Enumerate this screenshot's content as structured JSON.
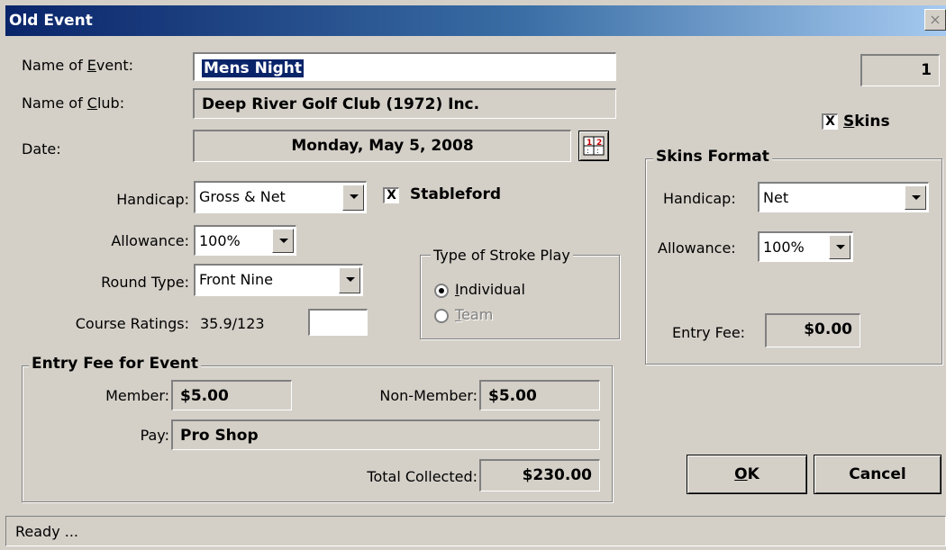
{
  "window": {
    "title": "Old Event",
    "close_label": "×"
  },
  "event": {
    "name_label_prefix": "Name of ",
    "name_label_key": "E",
    "name_label_suffix": "vent:",
    "name_value": "Mens Night",
    "club_label_prefix": "Name of ",
    "club_label_key": "C",
    "club_label_suffix": "lub:",
    "club_value": "Deep River Golf Club (1972) Inc.",
    "date_label": "Date:",
    "date_value": "Monday, May 5, 2008",
    "calendar_icon": "calendar-icon",
    "event_number": "1"
  },
  "settings": {
    "handicap_label": "Handicap:",
    "handicap_value": "Gross & Net",
    "stableford_label": "Stableford",
    "stableford_checked": true,
    "stableford_mark": "X",
    "allowance_label": "Allowance:",
    "allowance_value": "100%",
    "round_type_label": "Round Type:",
    "round_type_value": "Front Nine",
    "course_ratings_label": "Course Ratings:",
    "course_ratings_value": "35.9/123",
    "course_ratings_input": ""
  },
  "stroke_play": {
    "title": "Type of Stroke Play",
    "individual_key": "I",
    "individual_rest": "ndividual",
    "individual_selected": true,
    "team_key": "T",
    "team_rest": "eam",
    "team_selected": false
  },
  "entry_fee": {
    "title": "Entry Fee for Event",
    "member_label": "Member:",
    "member_value": "$5.00",
    "non_member_label": "Non-Member:",
    "non_member_value": "$5.00",
    "pay_label": "Pay:",
    "pay_value": "Pro Shop",
    "total_label": "Total Collected:",
    "total_value": "$230.00"
  },
  "skins": {
    "checkbox_key": "S",
    "checkbox_rest": "kins",
    "checked": true,
    "mark": "X",
    "format_title": "Skins Format",
    "handicap_label": "Handicap:",
    "handicap_value": "Net",
    "allowance_label": "Allowance:",
    "allowance_value": "100%",
    "entry_fee_label": "Entry Fee:",
    "entry_fee_value": "$0.00"
  },
  "buttons": {
    "ok_key": "O",
    "ok_rest": "K",
    "cancel": "Cancel"
  },
  "status": {
    "text": "Ready ..."
  }
}
